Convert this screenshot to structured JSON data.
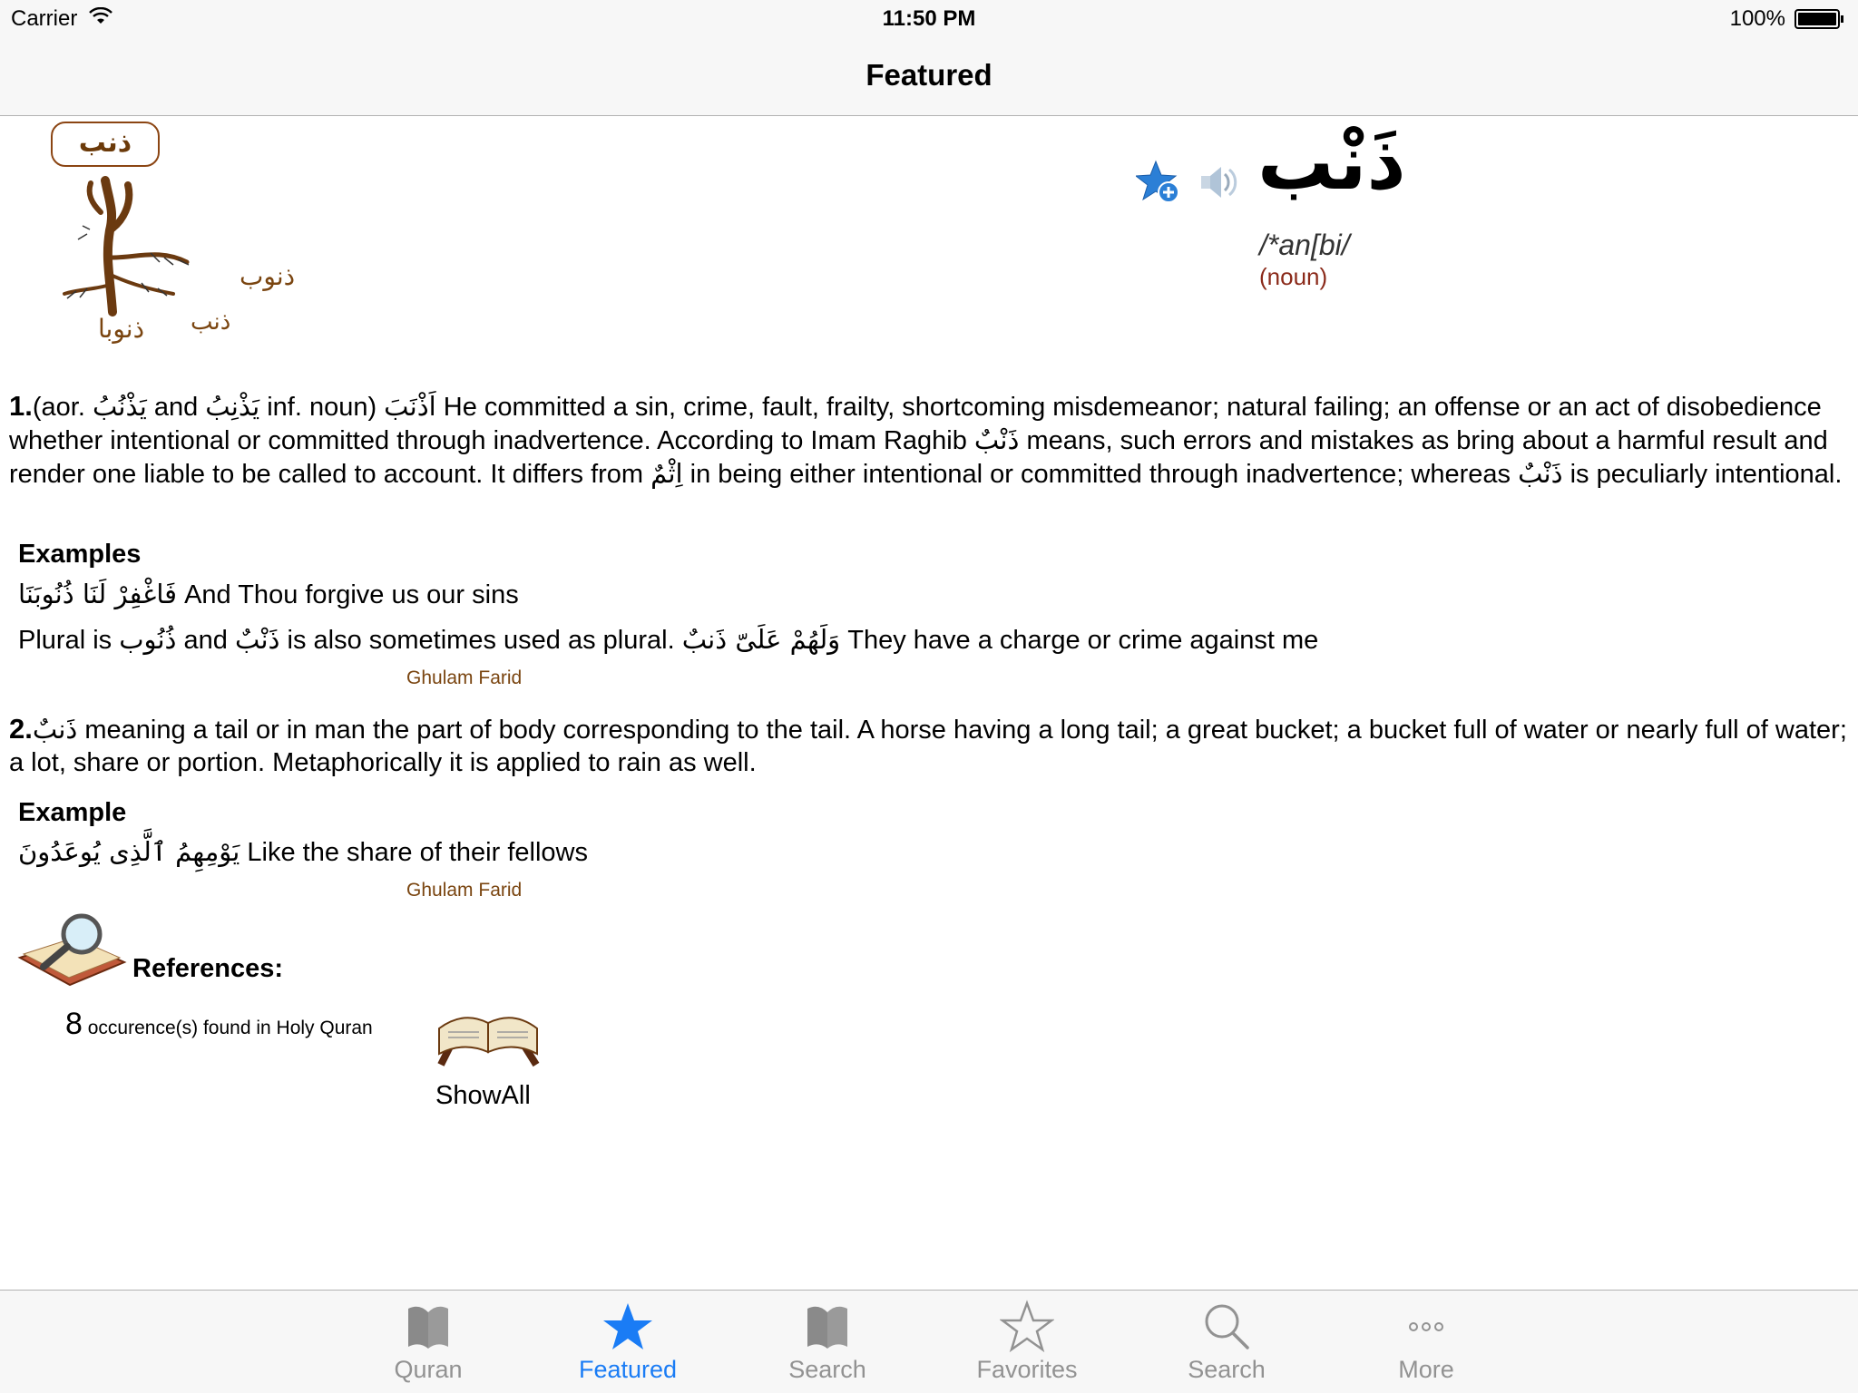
{
  "status_bar": {
    "carrier": "Carrier",
    "time": "11:50 PM",
    "battery": "100%"
  },
  "nav": {
    "title": "Featured"
  },
  "root": {
    "badge": "ذنب",
    "branches": [
      "ذنوب",
      "ذنوبا",
      "ذنب"
    ]
  },
  "entry": {
    "headword": "ذَنْب",
    "pronunciation": "/*an[bi/",
    "part_of_speech": "(noun)"
  },
  "definition1": {
    "number": "1.",
    "text_a": "(aor. ",
    "ar_a": "يَذْنُبُ",
    "text_b": " and ",
    "ar_b": "يَذْنِبُ",
    "text_c": " inf. noun)  ",
    "ar_c": "اَذْنَبَ",
    "text_d": " He committed a sin, crime, fault, frailty, shortcoming misdemeanor; natural failing; an offense or an act of disobedience whether intentional or committed through inadvertence. According to Imam Raghib ",
    "ar_d": "ذَنْبٌ",
    "text_e": " means, such errors and mistakes as bring about a harmful result and render one liable to be called to account. It differs from ",
    "ar_e": "اِثْمٌ",
    "text_f": " in being either intentional or committed through inadvertence; whereas ",
    "ar_f": "ذَنْبٌ",
    "text_g": " is peculiarly intentional."
  },
  "examples1": {
    "heading": "Examples",
    "line1_ar": "فَاغْفِرْ لَنَا ذُنُوبَنَا",
    "line1_en": " And Thou forgive us our sins",
    "line2_a": "Plural is ",
    "line2_ar_a": "ذُنُوب",
    "line2_b": " and ",
    "line2_ar_b": "ذَنْبٌ",
    "line2_c": " is also sometimes used as plural. ",
    "line2_ar_c": "وَلَهُمْ عَلَىّ ذَنبٌ",
    "line2_d": " They have a charge or crime against me",
    "credit": "Ghulam Farid"
  },
  "definition2": {
    "number": "2.",
    "ar": "ذَنبٌ",
    "text": " meaning a tail or in man the part of body corresponding to the tail. A horse having a long tail; a great bucket; a bucket full of water or nearly full of water; a lot, share or portion. Metaphorically it is applied to rain as well."
  },
  "examples2": {
    "heading": "Example",
    "line1_ar": "يَوْمِهِمُ ٱلَّذِى يُوعَدُونَ",
    "line1_en": " Like the share of their fellows",
    "credit": "Ghulam Farid"
  },
  "references": {
    "heading": "References:",
    "count": "8",
    "occurrence_text": " occurence(s) found in Holy Quran",
    "show_all": "ShowAll"
  },
  "tabs": [
    {
      "label": "Quran",
      "icon": "book-icon"
    },
    {
      "label": "Featured",
      "icon": "star-filled-icon"
    },
    {
      "label": "Search",
      "icon": "book-icon"
    },
    {
      "label": "Favorites",
      "icon": "star-outline-icon"
    },
    {
      "label": "Search",
      "icon": "magnifier-icon"
    },
    {
      "label": "More",
      "icon": "more-icon"
    }
  ],
  "colors": {
    "accent": "#1a7cf5",
    "tab_inactive": "#929292",
    "root_brown": "#7a4510",
    "pos_red": "#8b2a1a"
  }
}
